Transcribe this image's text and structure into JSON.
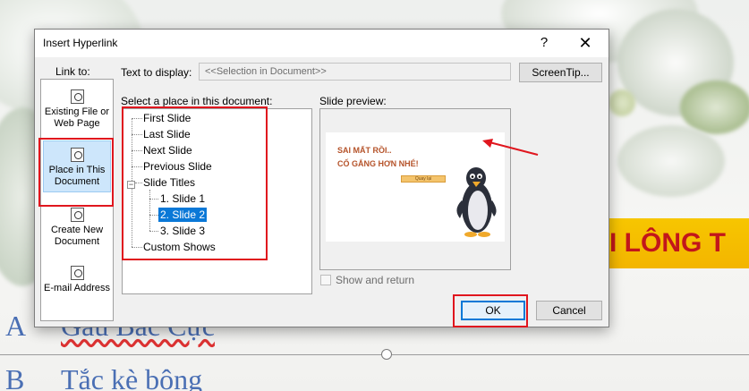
{
  "dialog": {
    "title": "Insert Hyperlink",
    "help_label": "?",
    "close_label": "✕",
    "link_to_label": "Link to:",
    "link_to_items": [
      {
        "label": "Existing File or Web Page",
        "icon": "web-page-icon"
      },
      {
        "label": "Place in This Document",
        "icon": "document-place-icon",
        "selected": true
      },
      {
        "label": "Create New Document",
        "icon": "new-document-icon"
      },
      {
        "label": "E-mail Address",
        "icon": "email-icon"
      }
    ],
    "text_to_display_label": "Text to display:",
    "text_to_display_value": "<<Selection in Document>>",
    "screentip_label": "ScreenTip...",
    "select_place_label": "Select a place in this document:",
    "tree": {
      "first_slide": "First Slide",
      "last_slide": "Last Slide",
      "next_slide": "Next Slide",
      "previous_slide": "Previous Slide",
      "slide_titles": "Slide Titles",
      "expander": "−",
      "slides": [
        "1. Slide 1",
        "2. Slide 2",
        "3. Slide 3"
      ],
      "selected_slide": "2. Slide 2",
      "custom_shows": "Custom Shows"
    },
    "preview_label": "Slide preview:",
    "preview_text_line1": "SAI MẤT RỒI..",
    "preview_text_line2": "CỐ GẮNG HƠN NHÉ!",
    "preview_button_label": "Quay lại",
    "show_and_return_label": "Show and return",
    "show_and_return_checked": false,
    "ok_label": "OK",
    "cancel_label": "Cancel"
  },
  "background": {
    "slide_banner_text": "I LÔNG T",
    "answer_a_letter": "A",
    "answer_a_text": "Gấu Bắc Cực",
    "answer_b_letter": "B",
    "answer_b_text": "Tắc kè bông"
  },
  "colors": {
    "annotation_red": "#e0161e",
    "selection_blue": "#0a78d7",
    "banner_yellow": "#f3b500",
    "banner_text_red": "#c2161b",
    "answer_blue": "#4a6fb4"
  }
}
